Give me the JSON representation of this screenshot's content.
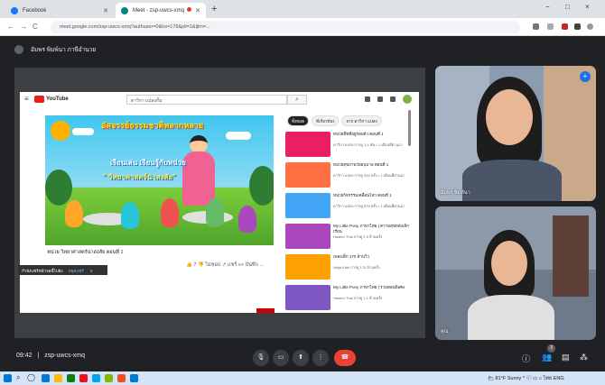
{
  "browser": {
    "tabs": [
      {
        "label": "Facebook",
        "active": false,
        "color": "#1877f2"
      },
      {
        "label": "Meet - zsp-uwcs-xmq",
        "active": true,
        "color": "#00897b"
      }
    ],
    "new_tab": "+",
    "url": "meet.google.com/zsp-uwcs-xmq?authuser=0&hs=179&pli=1&ijlm=...",
    "window_controls": [
      "−",
      "□",
      "×"
    ]
  },
  "meet": {
    "presenter_label": "อัมพร พิมพ์นา ภาษีอำนวย",
    "meeting_code": "zsp-uwcs-xmq",
    "time": "09:42",
    "separator": "|",
    "participants_badge": "3",
    "participants": [
      {
        "name": "อัมพร พิมพ์นา"
      },
      {
        "name": "คุณ"
      }
    ],
    "menu_dots": "⋮"
  },
  "youtube": {
    "logo_text": "YouTube",
    "search_value": "ดาวิกา แปลงกั้ม",
    "search_icon": "search-icon",
    "video_title_line1": "อัศจรรย์ธรรมชาติหลากหลาย",
    "video_title_line2": "เรียนเล่น เรียนรู้กับหน่วย",
    "video_title_line3": "\" วิทยาศาสตร์น่าสงสัย\"",
    "caption": "หน่วย วิทยาศาสตร์น่าสงสัย ตอนที่ 1",
    "meta": "👍 7   👎 ไม่ชอบ   ↗ แชร์   ≡+ บันทึก  ...",
    "notice_text": "กำลังแชร์หน้าจอนี้ไปยัง",
    "notice_link": "หยุดแชร์",
    "notice_close": "×",
    "chips": [
      "ทั้งหมด",
      "ที่เกี่ยวข้อง",
      "จาก ดาวิกา แปลง"
    ],
    "recommendations": [
      {
        "title": "หน่วยพืชที่อยู่รอบตัว ตอนที่ 1",
        "channel": "ดาวิกา แปลง\nการดู 1.4 พัน • 1 เดือนที่ผ่านมา",
        "duration": "6:14",
        "color": "#e91e63"
      },
      {
        "title": "หน่วยสุขภาพวัยอนุบาล ตอนที่ 1",
        "channel": "ดาวิกา แปลง\nการดู 932 ครั้ง • 1 เดือนที่ผ่านมา",
        "duration": "5:21",
        "color": "#ff7043"
      },
      {
        "title": "หน่วยกิจกรรมเคลื่อนไหว ตอนที่ 1",
        "channel": "ดาวิกา แปลง\nการดู 875 ครั้ง • 1 เดือนที่ผ่านมา",
        "duration": "4:48",
        "color": "#42a5f5"
      },
      {
        "title": "My Little Pony ภาษาไทย | ความสุขหลังเลิกเรียน",
        "channel": "Hasbro Thai\nการดู 2.3 ล้านครั้ง",
        "duration": "22:10",
        "color": "#ab47bc"
      },
      {
        "title": "เพลงเด็ก 170 ล้านวิว",
        "channel": "Ninja Kids\nการดู 170 ล้านครั้ง",
        "duration": "1:05:12",
        "color": "#ffa000"
      },
      {
        "title": "My Little Pony ภาษาไทย | รวมตอนพิเศษ",
        "channel": "Hasbro Thai\nการดู 1.1 ล้านครั้ง",
        "duration": "44:01",
        "color": "#7e57c2"
      }
    ]
  },
  "taskbar": {
    "tray_text": "🌥 81°F Sunny  ^  ⓘ  ▭  ⌂  ไทย  ENG",
    "icons": [
      "#0078d4",
      "#ffb900",
      "#107c10",
      "#e81123",
      "#0078d4",
      "#00a4ef",
      "#7fba00",
      "#f25022"
    ]
  }
}
